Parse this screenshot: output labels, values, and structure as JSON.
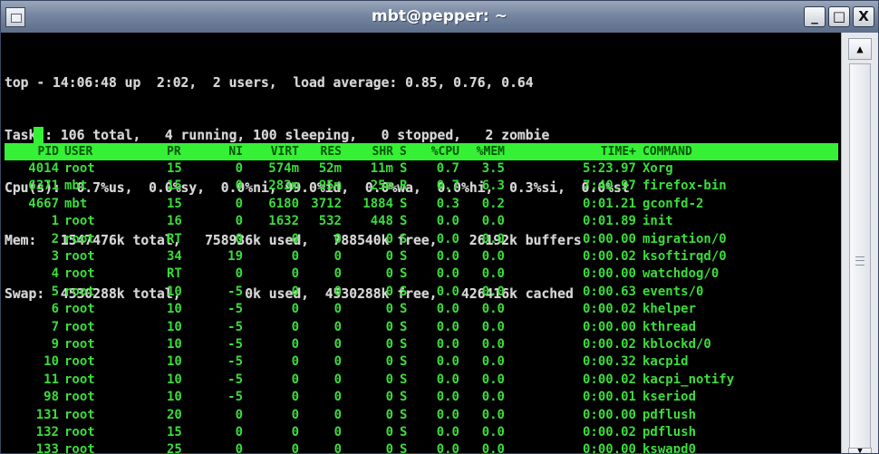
{
  "window": {
    "title": "mbt@pepper: ~",
    "buttons": {
      "minimize": "_",
      "maximize": "□",
      "close": "X"
    }
  },
  "summary": {
    "lines": [
      "top - 14:06:48 up  2:02,  2 users,  load average: 0.85, 0.76, 0.64",
      "Tasks: 106 total,   4 running, 100 sleeping,   0 stopped,   2 zombie",
      "Cpu(s):  0.7%us,  0.0%sy,  0.0%ni, 99.0%id,  0.0%wa,  0.0%hi,  0.3%si,  0.0%st",
      "Mem:   1547476k total,   758936k used,   788540k free,    26192k buffers",
      "Swap:  4530288k total,        0k used,  4530288k free,   426416k cached"
    ]
  },
  "table": {
    "columns": [
      "PID",
      "USER",
      "PR",
      "NI",
      "VIRT",
      "RES",
      "SHR",
      "S",
      "%CPU",
      "%MEM",
      "TIME+",
      "COMMAND"
    ],
    "rows": [
      [
        "4014",
        "root",
        "15",
        "0",
        "574m",
        "52m",
        "11m",
        "S",
        "0.7",
        "3.5",
        "5:23.97",
        "Xorg"
      ],
      [
        "6371",
        "mbt",
        "15",
        "0",
        "283m",
        "95m",
        "25m",
        "R",
        "0.7",
        "6.3",
        "7:40.97",
        "firefox-bin"
      ],
      [
        "4667",
        "mbt",
        "15",
        "0",
        "6180",
        "3712",
        "1884",
        "S",
        "0.3",
        "0.2",
        "0:01.21",
        "gconfd-2"
      ],
      [
        "1",
        "root",
        "16",
        "0",
        "1632",
        "532",
        "448",
        "S",
        "0.0",
        "0.0",
        "0:01.89",
        "init"
      ],
      [
        "2",
        "root",
        "RT",
        "0",
        "0",
        "0",
        "0",
        "S",
        "0.0",
        "0.0",
        "0:00.00",
        "migration/0"
      ],
      [
        "3",
        "root",
        "34",
        "19",
        "0",
        "0",
        "0",
        "S",
        "0.0",
        "0.0",
        "0:00.02",
        "ksoftirqd/0"
      ],
      [
        "4",
        "root",
        "RT",
        "0",
        "0",
        "0",
        "0",
        "S",
        "0.0",
        "0.0",
        "0:00.00",
        "watchdog/0"
      ],
      [
        "5",
        "root",
        "10",
        "-5",
        "0",
        "0",
        "0",
        "S",
        "0.0",
        "0.0",
        "0:00.63",
        "events/0"
      ],
      [
        "6",
        "root",
        "10",
        "-5",
        "0",
        "0",
        "0",
        "S",
        "0.0",
        "0.0",
        "0:00.02",
        "khelper"
      ],
      [
        "7",
        "root",
        "10",
        "-5",
        "0",
        "0",
        "0",
        "S",
        "0.0",
        "0.0",
        "0:00.00",
        "kthread"
      ],
      [
        "9",
        "root",
        "10",
        "-5",
        "0",
        "0",
        "0",
        "S",
        "0.0",
        "0.0",
        "0:00.02",
        "kblockd/0"
      ],
      [
        "10",
        "root",
        "10",
        "-5",
        "0",
        "0",
        "0",
        "S",
        "0.0",
        "0.0",
        "0:00.32",
        "kacpid"
      ],
      [
        "11",
        "root",
        "10",
        "-5",
        "0",
        "0",
        "0",
        "S",
        "0.0",
        "0.0",
        "0:00.02",
        "kacpi_notify"
      ],
      [
        "98",
        "root",
        "10",
        "-5",
        "0",
        "0",
        "0",
        "S",
        "0.0",
        "0.0",
        "0:00.01",
        "kseriod"
      ],
      [
        "131",
        "root",
        "20",
        "0",
        "0",
        "0",
        "0",
        "S",
        "0.0",
        "0.0",
        "0:00.00",
        "pdflush"
      ],
      [
        "132",
        "root",
        "15",
        "0",
        "0",
        "0",
        "0",
        "S",
        "0.0",
        "0.0",
        "0:00.02",
        "pdflush"
      ],
      [
        "133",
        "root",
        "25",
        "0",
        "0",
        "0",
        "0",
        "S",
        "0.0",
        "0.0",
        "0:00.00",
        "kswapd0"
      ]
    ]
  },
  "colors": {
    "text_green": "#3bdc3b",
    "header_bg": "#36f036",
    "summary_text": "#d4d4d4",
    "background": "#000000"
  },
  "icons": {
    "menu": "window-menu-icon",
    "scroll_up": "▲",
    "scroll_down": "▼"
  }
}
